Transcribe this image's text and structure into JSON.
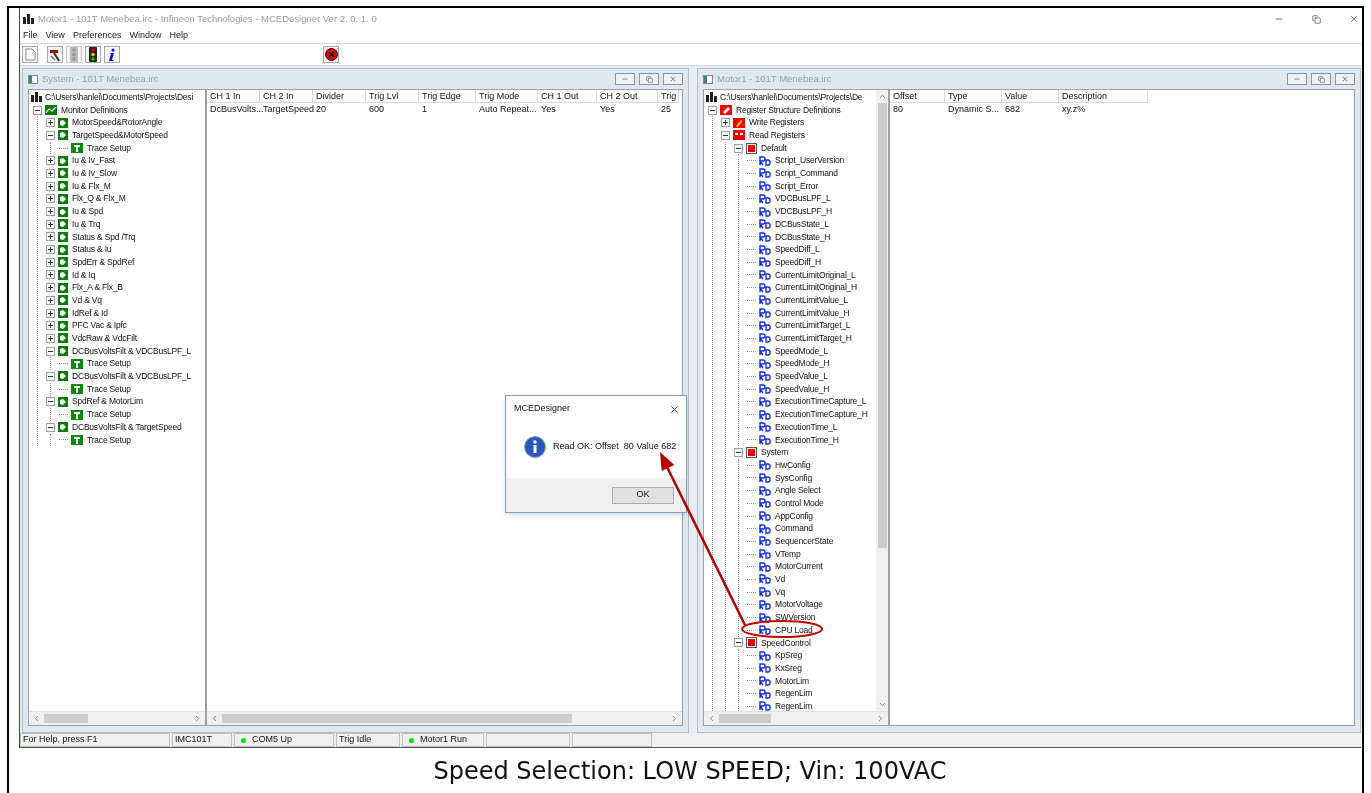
{
  "app": {
    "title": "Motor1  - 101T Menebea.irc - Infineon Technologies -  MCEDesigner Ver 2. 0. 1. 0",
    "menu": [
      "File",
      "View",
      "Preferences",
      "Window",
      "Help"
    ],
    "toolbar": [
      {
        "kind": "document",
        "disabled": false
      },
      {
        "kind": "tool",
        "disabled": false
      },
      {
        "kind": "traffic-light",
        "disabled": true
      },
      {
        "kind": "traffic-light",
        "disabled": false
      },
      {
        "kind": "info",
        "disabled": false
      },
      {
        "kind": "stop",
        "disabled": false
      }
    ]
  },
  "windows": [
    {
      "title": "System  - 101T Menebea.irc",
      "tree": {
        "path": "C:\\Users\\hanlei\\Documents\\Projects\\Desi",
        "items": [
          {
            "label": "Monitor Definitions",
            "kind": "monitor",
            "expanded": true,
            "children": [
              {
                "label": "MotorSpeed&RotorAngle",
                "kind": "group",
                "expanded": false
              },
              {
                "label": "TargetSpeed&MotorSpeed",
                "kind": "group",
                "expanded": true,
                "children": [
                  {
                    "label": "Trace Setup",
                    "kind": "trace"
                  }
                ]
              },
              {
                "label": "Iu & Iv_Fast",
                "kind": "group",
                "expanded": false
              },
              {
                "label": "Iu & Iv_Slow",
                "kind": "group",
                "expanded": false
              },
              {
                "label": "Iu & Flx_M",
                "kind": "group",
                "expanded": false
              },
              {
                "label": "Flx_Q & Flx_M",
                "kind": "group",
                "expanded": false
              },
              {
                "label": "Iu & Spd",
                "kind": "group",
                "expanded": false
              },
              {
                "label": "Iu & Trq",
                "kind": "group",
                "expanded": false
              },
              {
                "label": "Status & Spd /Trq",
                "kind": "group",
                "expanded": false
              },
              {
                "label": "Status & Iu",
                "kind": "group",
                "expanded": false
              },
              {
                "label": "SpdErr & SpdRef",
                "kind": "group",
                "expanded": false
              },
              {
                "label": "Id & Iq",
                "kind": "group",
                "expanded": false
              },
              {
                "label": "Flx_A & Flx_B",
                "kind": "group",
                "expanded": false
              },
              {
                "label": "Vd & Vq",
                "kind": "group",
                "expanded": false
              },
              {
                "label": "IdRef & Id",
                "kind": "group",
                "expanded": false
              },
              {
                "label": "PFC Vac & Ipfc",
                "kind": "group",
                "expanded": false
              },
              {
                "label": "VdcRaw & VdcFilt",
                "kind": "group",
                "expanded": false
              },
              {
                "label": "DCBusVoltsFilt & VDCBusLPF_L",
                "kind": "group",
                "expanded": true,
                "children": [
                  {
                    "label": "Trace Setup",
                    "kind": "trace"
                  }
                ]
              },
              {
                "label": "DCBusVoltsFilt & VDCBusLPF_L",
                "kind": "group",
                "expanded": true,
                "children": [
                  {
                    "label": "Trace Setup",
                    "kind": "trace"
                  }
                ]
              },
              {
                "label": "SpdRef & MotorLim",
                "kind": "group",
                "expanded": true,
                "children": [
                  {
                    "label": "Trace Setup",
                    "kind": "trace"
                  }
                ]
              },
              {
                "label": "DCBusVoltsFilt & TargetSpeed",
                "kind": "group",
                "expanded": true,
                "children": [
                  {
                    "label": "Trace Setup",
                    "kind": "trace"
                  }
                ]
              }
            ]
          }
        ]
      },
      "table": {
        "columns": [
          "CH 1 In",
          "CH 2 In",
          "Divider",
          "Trig Lvl",
          "Trig Edge",
          "Trig Mode",
          "CH 1 Out",
          "CH 2 Out",
          "Trig"
        ],
        "rows": [
          [
            "DcBusVolts...",
            "TargetSpeed",
            "20",
            "600",
            "1",
            "Auto Repeat...",
            "Yes",
            "Yes",
            "25"
          ]
        ]
      }
    },
    {
      "title": "Motor1  - 101T Menebea.irc",
      "tree": {
        "path": "C:\\Users\\hanlei\\Documents\\Projects\\De",
        "items": [
          {
            "label": "Register Structure Definitions",
            "kind": "registers",
            "expanded": true,
            "children": [
              {
                "label": "Write Registers",
                "kind": "write",
                "expanded": false
              },
              {
                "label": "Read Registers",
                "kind": "read",
                "expanded": true,
                "children": [
                  {
                    "label": "Default",
                    "kind": "folder",
                    "expanded": true,
                    "children": [
                      {
                        "label": "Script_UserVersion",
                        "kind": "register"
                      },
                      {
                        "label": "Script_Command",
                        "kind": "register"
                      },
                      {
                        "label": "Script_Error",
                        "kind": "register"
                      },
                      {
                        "label": "VDCBusLPF_L",
                        "kind": "register"
                      },
                      {
                        "label": "VDCBusLPF_H",
                        "kind": "register"
                      },
                      {
                        "label": "DCBusState_L",
                        "kind": "register"
                      },
                      {
                        "label": "DCBusState_H",
                        "kind": "register"
                      },
                      {
                        "label": "SpeedDiff_L",
                        "kind": "register"
                      },
                      {
                        "label": "SpeedDiff_H",
                        "kind": "register"
                      },
                      {
                        "label": "CurrentLimitOriginal_L",
                        "kind": "register"
                      },
                      {
                        "label": "CurrentLimitOriginal_H",
                        "kind": "register"
                      },
                      {
                        "label": "CurrentLimitValue_L",
                        "kind": "register"
                      },
                      {
                        "label": "CurrentLimitValue_H",
                        "kind": "register"
                      },
                      {
                        "label": "CurrentLimitTarget_L",
                        "kind": "register"
                      },
                      {
                        "label": "CurrentLimitTarget_H",
                        "kind": "register"
                      },
                      {
                        "label": "SpeedMode_L",
                        "kind": "register"
                      },
                      {
                        "label": "SpeedMode_H",
                        "kind": "register"
                      },
                      {
                        "label": "SpeedValue_L",
                        "kind": "register"
                      },
                      {
                        "label": "SpeedValue_H",
                        "kind": "register"
                      },
                      {
                        "label": "ExecutionTimeCapture_L",
                        "kind": "register"
                      },
                      {
                        "label": "ExecutionTimeCapture_H",
                        "kind": "register"
                      },
                      {
                        "label": "ExecutionTime_L",
                        "kind": "register"
                      },
                      {
                        "label": "ExecutionTime_H",
                        "kind": "register"
                      }
                    ]
                  },
                  {
                    "label": "System",
                    "kind": "folder",
                    "expanded": true,
                    "children": [
                      {
                        "label": "HwConfig",
                        "kind": "register"
                      },
                      {
                        "label": "SysConfig",
                        "kind": "register"
                      },
                      {
                        "label": "Angle Select",
                        "kind": "register"
                      },
                      {
                        "label": "Control Mode",
                        "kind": "register"
                      },
                      {
                        "label": "AppConfig",
                        "kind": "register"
                      },
                      {
                        "label": "Command",
                        "kind": "register"
                      },
                      {
                        "label": "SequencerState",
                        "kind": "register"
                      },
                      {
                        "label": "VTemp",
                        "kind": "register"
                      },
                      {
                        "label": "MotorCurrent",
                        "kind": "register"
                      },
                      {
                        "label": "Vd",
                        "kind": "register"
                      },
                      {
                        "label": "Vq",
                        "kind": "register"
                      },
                      {
                        "label": "MotorVoltage",
                        "kind": "register"
                      },
                      {
                        "label": "SWVersion",
                        "kind": "register"
                      },
                      {
                        "label": "CPU Load",
                        "kind": "register"
                      }
                    ]
                  },
                  {
                    "label": "SpeedControl",
                    "kind": "folder",
                    "expanded": true,
                    "children": [
                      {
                        "label": "KpSreg",
                        "kind": "register"
                      },
                      {
                        "label": "KxSreg",
                        "kind": "register"
                      },
                      {
                        "label": "MotorLim",
                        "kind": "register"
                      },
                      {
                        "label": "RegenLim",
                        "kind": "register"
                      },
                      {
                        "label": "RegenLim",
                        "kind": "register"
                      }
                    ]
                  }
                ]
              }
            ]
          }
        ]
      },
      "table": {
        "columns": [
          "Offset",
          "Type",
          "Value",
          "Description"
        ],
        "rows": [
          [
            "80",
            "Dynamic S...",
            "682",
            "xy.z%"
          ]
        ]
      }
    }
  ],
  "dialog": {
    "title": "MCEDesigner",
    "message": "Read OK: Offset  80 Value 682",
    "button": "OK"
  },
  "status_bar": [
    {
      "kind": "text",
      "text": "For Help, press F1"
    },
    {
      "kind": "text",
      "text": "IMC101T"
    },
    {
      "kind": "indicator",
      "text": "COM5 Up",
      "color": "#00e000"
    },
    {
      "kind": "text",
      "text": "Trig Idle"
    },
    {
      "kind": "indicator",
      "text": "Motor1  Run",
      "color": "#00e000"
    },
    {
      "kind": "empty"
    },
    {
      "kind": "empty"
    }
  ],
  "caption": "Speed Selection: LOW SPEED; Vin: 100VAC"
}
